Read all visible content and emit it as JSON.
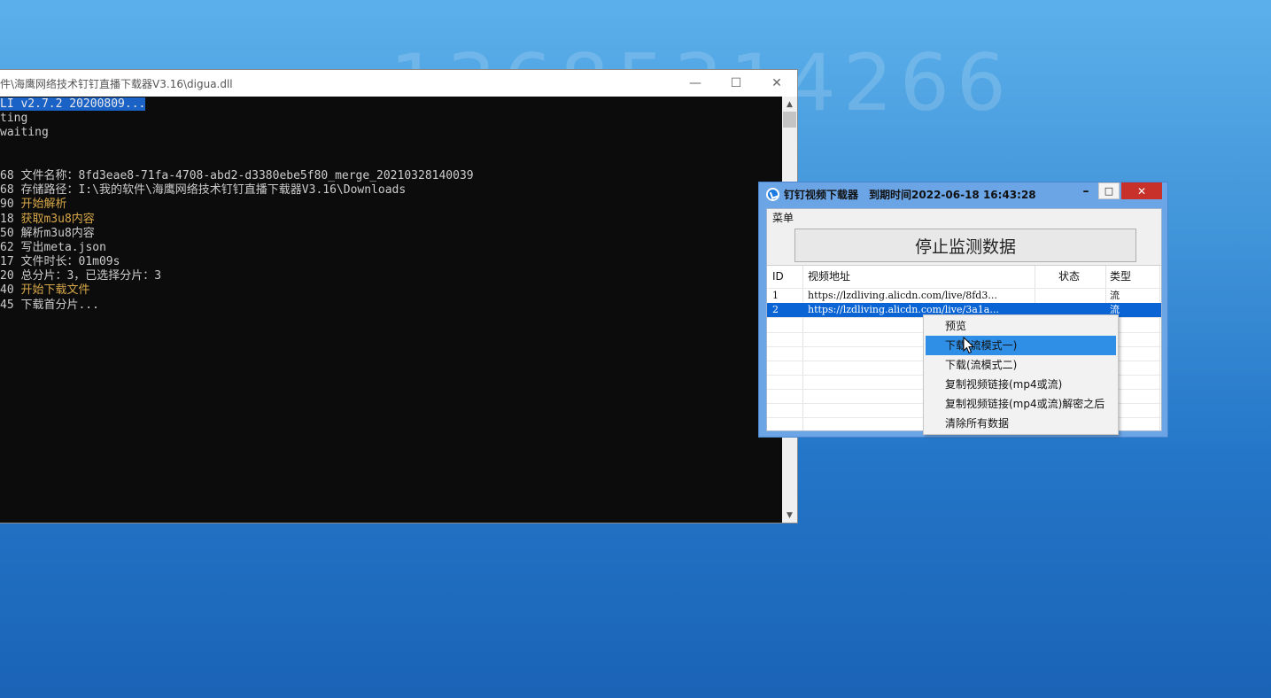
{
  "wallpaper": {
    "number": "13685314266"
  },
  "console": {
    "title": "件\\海鹰网络技术钉钉直播下载器V3.16\\digua.dll",
    "controls": {
      "minimize": "—",
      "maximize": "☐",
      "close": "✕"
    },
    "lines": [
      {
        "text": "LI v2.7.2 20200809...",
        "highlight": true
      },
      {
        "text": "ting"
      },
      {
        "text": "waiting"
      },
      {
        "text": ""
      },
      {
        "text": ""
      },
      {
        "text": "68 文件名称：8fd3eae8-71fa-4708-abd2-d3380ebe5f80_merge_20210328140039"
      },
      {
        "text": "68 存储路径：I:\\我的软件\\海鹰网络技术钉钉直播下载器V3.16\\Downloads"
      },
      {
        "prefix": "90 ",
        "text": "开始解析",
        "color": "yellow"
      },
      {
        "prefix": "18 ",
        "text": "获取m3u8内容",
        "color": "yellow"
      },
      {
        "text": "50 解析m3u8内容"
      },
      {
        "text": "62 写出meta.json"
      },
      {
        "text": "17 文件时长：01m09s"
      },
      {
        "text": "20 总分片：3，已选择分片：3"
      },
      {
        "prefix": "40 ",
        "text": "开始下载文件",
        "color": "yellow"
      },
      {
        "text": "45 下载首分片..."
      }
    ]
  },
  "downloader": {
    "title": "钉钉视频下载器",
    "expiry": "到期时间2022-06-18 16:43:28",
    "controls": {
      "minimize": "–",
      "maximize": "□",
      "close": "✕"
    },
    "menu_label": "菜单",
    "stop_button": "停止监测数据",
    "table": {
      "columns": [
        "ID",
        "视频地址",
        "状态",
        "类型"
      ],
      "rows": [
        {
          "id": "1",
          "url": "https://lzdliving.alicdn.com/live/8fd3...",
          "status": "",
          "type": "流",
          "selected": false
        },
        {
          "id": "2",
          "url": "https://lzdliving.alicdn.com/live/3a1a...",
          "status": "",
          "type": "流",
          "selected": true
        }
      ]
    }
  },
  "context_menu": {
    "items": [
      {
        "label": "预览",
        "active": false
      },
      {
        "label": "下载(流模式一)",
        "active": true
      },
      {
        "label": "下载(流模式二)",
        "active": false
      },
      {
        "label": "复制视频链接(mp4或流)",
        "active": false
      },
      {
        "label": "复制视频链接(mp4或流)解密之后",
        "active": false
      },
      {
        "label": "清除所有数据",
        "active": false
      }
    ]
  }
}
